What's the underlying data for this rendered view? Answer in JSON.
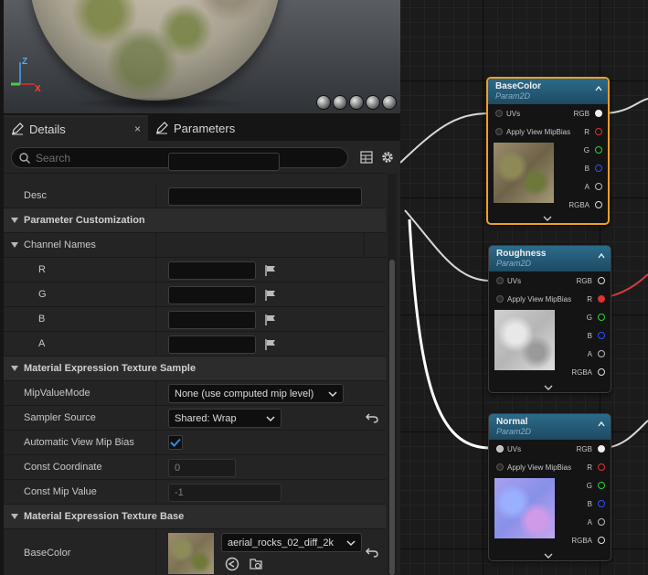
{
  "viewport": {
    "axis": {
      "z": "Z",
      "x": "X"
    },
    "view_mode_icons": [
      "cylinder-preview-icon",
      "sphere-preview-icon",
      "plane-preview-icon",
      "cube-preview-icon",
      "custom-mesh-preview-icon"
    ]
  },
  "tabs": {
    "details": "Details",
    "parameters": "Parameters",
    "close": "×"
  },
  "search": {
    "placeholder": "Search"
  },
  "details": {
    "desc_label": "Desc",
    "section_param_custom": "Parameter Customization",
    "channel_names_label": "Channel Names",
    "channel_r": "R",
    "channel_g": "G",
    "channel_b": "B",
    "channel_a": "A",
    "section_texture_sample": "Material Expression Texture Sample",
    "mip_value_mode_label": "MipValueMode",
    "mip_value_mode_value": "None (use computed mip level)",
    "sampler_source_label": "Sampler Source",
    "sampler_source_value": "Shared: Wrap",
    "auto_view_mip_bias_label": "Automatic View Mip Bias",
    "auto_view_mip_bias_checked": true,
    "const_coordinate_label": "Const Coordinate",
    "const_coordinate_value": "0",
    "const_mip_value_label": "Const Mip Value",
    "const_mip_value_value": "-1",
    "section_texture_base": "Material Expression Texture Base",
    "basecolor_label": "BaseColor",
    "basecolor_texture": "aerial_rocks_02_diff_2k"
  },
  "graph": {
    "pin_labels": {
      "uvs": "UVs",
      "apply_mip": "Apply View MipBias",
      "rgb": "RGB",
      "r": "R",
      "g": "G",
      "b": "B",
      "a": "A",
      "rgba": "RGBA"
    },
    "nodes": [
      {
        "title": "BaseColor",
        "subtitle": "Param2D",
        "selected": true
      },
      {
        "title": "Roughness",
        "subtitle": "Param2D",
        "selected": false
      },
      {
        "title": "Normal",
        "subtitle": "Param2D",
        "selected": false
      }
    ]
  },
  "colors": {
    "selection": "#f0a020",
    "node_header": "#2c6b8a",
    "pin_r": "#e03030",
    "pin_g": "#30d040",
    "pin_b": "#3050ff",
    "checkbox_accent": "#2f8de0"
  }
}
